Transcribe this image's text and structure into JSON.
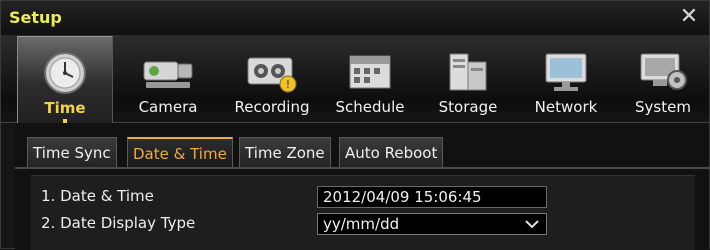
{
  "window": {
    "title": "Setup",
    "close_icon": "close-icon"
  },
  "categories": [
    {
      "label": "Time",
      "icon": "clock-icon",
      "active": true
    },
    {
      "label": "Camera",
      "icon": "camera-icon"
    },
    {
      "label": "Recording",
      "icon": "recorder-icon"
    },
    {
      "label": "Schedule",
      "icon": "schedule-icon"
    },
    {
      "label": "Storage",
      "icon": "storage-icon"
    },
    {
      "label": "Network",
      "icon": "network-icon"
    },
    {
      "label": "System",
      "icon": "system-icon"
    }
  ],
  "subtabs": [
    {
      "label": "Time Sync"
    },
    {
      "label": "Date & Time",
      "active": true
    },
    {
      "label": "Time Zone"
    },
    {
      "label": "Auto Reboot"
    }
  ],
  "settings": {
    "date_time": {
      "label": "1. Date & Time",
      "value": "2012/04/09  15:06:45"
    },
    "date_display_type": {
      "label": "2. Date Display Type",
      "value": "yy/mm/dd"
    }
  },
  "colors": {
    "title": "#ecec55",
    "active_category": "#f5d24b",
    "active_subtab": "#f2a845"
  }
}
